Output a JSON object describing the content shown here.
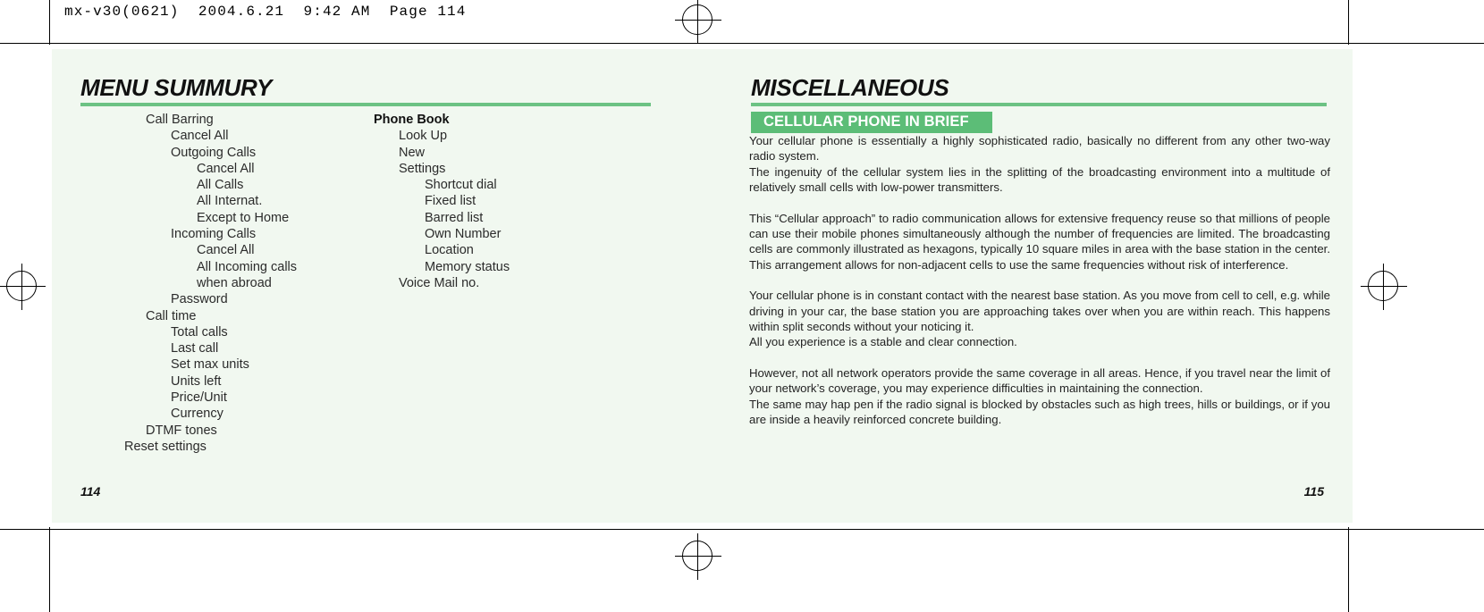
{
  "slug": {
    "text": "mx-v30(0621)  2004.6.21  9:42 AM  Page 114"
  },
  "colors": {
    "page_background": "#f1f8f0",
    "accent_green": "#6cc283",
    "band_green": "#5cbd77",
    "text": "#232323"
  },
  "left_page": {
    "title": "MENU SUMMURY",
    "folio": "114",
    "column_one": [
      {
        "label": "Call Barring",
        "level": 0
      },
      {
        "label": "Cancel All",
        "level": 1
      },
      {
        "label": "Outgoing Calls",
        "level": 1
      },
      {
        "label": "Cancel All",
        "level": 2
      },
      {
        "label": "All Calls",
        "level": 2
      },
      {
        "label": "All Internat.",
        "level": 2
      },
      {
        "label": "Except to Home",
        "level": 2
      },
      {
        "label": "Incoming Calls",
        "level": 1
      },
      {
        "label": "Cancel All",
        "level": 2
      },
      {
        "label": "All Incoming calls",
        "level": 2
      },
      {
        "label": "when abroad",
        "level": 2
      },
      {
        "label": "Password",
        "level": 1
      },
      {
        "label": "Call time",
        "level": 0
      },
      {
        "label": "Total calls",
        "level": 1
      },
      {
        "label": "Last call",
        "level": 1
      },
      {
        "label": "Set max units",
        "level": 1
      },
      {
        "label": "Units left",
        "level": 1
      },
      {
        "label": "Price/Unit",
        "level": 1
      },
      {
        "label": "Currency",
        "level": 1
      },
      {
        "label": "DTMF tones",
        "level": 0
      },
      {
        "label": "Reset settings",
        "level": -1
      }
    ],
    "column_two": [
      {
        "label": "Phone Book",
        "level": 0,
        "bold": true
      },
      {
        "label": "Look Up",
        "level": 1
      },
      {
        "label": "New",
        "level": 1
      },
      {
        "label": "Settings",
        "level": 1
      },
      {
        "label": "Shortcut dial",
        "level": 2
      },
      {
        "label": "Fixed list",
        "level": 2
      },
      {
        "label": "Barred list",
        "level": 2
      },
      {
        "label": "Own Number",
        "level": 2
      },
      {
        "label": "Location",
        "level": 2
      },
      {
        "label": "Memory status",
        "level": 2
      },
      {
        "label": "Voice Mail no.",
        "level": 1
      }
    ]
  },
  "right_page": {
    "title": "MISCELLANEOUS",
    "folio": "115",
    "section_heading": "CELLULAR PHONE IN BRIEF",
    "paragraphs": [
      {
        "gap": false,
        "text": "Your cellular phone is essentially a highly sophisticated radio, basically no different from any other two-way radio system."
      },
      {
        "gap": false,
        "text": "The ingenuity of the cellular system lies in the splitting of the broadcasting environment into a multitude of relatively small cells with low-power transmitters."
      },
      {
        "gap": true,
        "text": "This “Cellular approach” to radio communication allows for extensive frequency reuse so that millions of people can use their mobile phones simultaneously although the number of frequencies are limited. The broadcasting cells are commonly illustrated as hexagons, typically 10 square miles in area with the base station in the center. This arrangement allows for non-adjacent cells to use the same frequencies without risk of interference."
      },
      {
        "gap": true,
        "text": "Your cellular phone is in constant contact with the nearest base station. As you move from cell to cell, e.g. while driving in your car, the base station you are approaching takes over when you are within reach. This happens within split seconds without your noticing it."
      },
      {
        "gap": false,
        "text": "All you experience is a stable and clear connection."
      },
      {
        "gap": true,
        "text": "However, not all network operators provide the same coverage in all areas. Hence, if you travel near the limit of your network’s coverage, you may experience difficulties in maintaining the connection."
      },
      {
        "gap": false,
        "text": "The same may hap pen if the radio signal is blocked by obstacles such as high trees, hills or buildings, or if you are inside a heavily reinforced concrete building."
      }
    ]
  }
}
